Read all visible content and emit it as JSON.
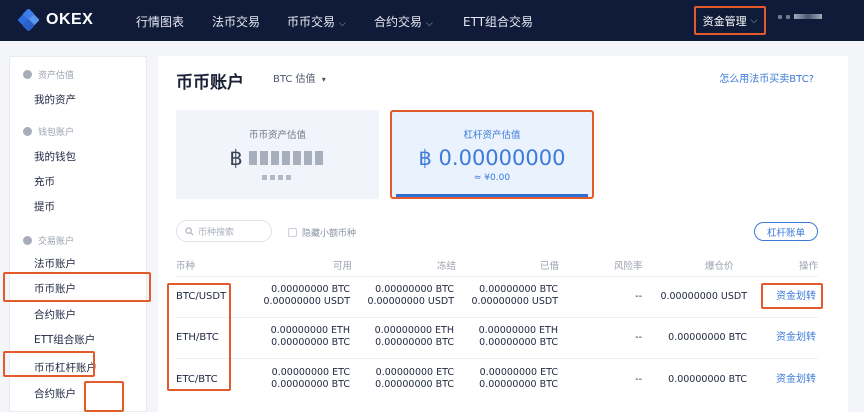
{
  "brand": {
    "name": "OKEX"
  },
  "nav": {
    "items": [
      {
        "label": "行情图表",
        "dropdown": false
      },
      {
        "label": "法币交易",
        "dropdown": false
      },
      {
        "label": "币币交易",
        "dropdown": true
      },
      {
        "label": "合约交易",
        "dropdown": true
      },
      {
        "label": "ETT组合交易",
        "dropdown": false
      }
    ],
    "fund_management": "资金管理"
  },
  "sidebar": {
    "groups": [
      {
        "label": "资产估值",
        "items": [
          "我的资产"
        ]
      },
      {
        "label": "钱包账户",
        "items": [
          "我的钱包",
          "充币",
          "提币"
        ]
      },
      {
        "label": "交易账户",
        "items": [
          "法币账户",
          "币币账户",
          "合约账户",
          "ETT组合账户",
          "币币杠杆账户",
          "合约账户"
        ]
      }
    ]
  },
  "main": {
    "title": "币币账户",
    "valuation_select": "BTC 估值",
    "help_link": "怎么用法币买卖BTC?",
    "spot_card": {
      "label": "币币资产估值",
      "currency_symbol": "฿"
    },
    "margin_card": {
      "label": "杠杆资产估值",
      "value": "฿ 0.00000000",
      "fiat": "≈ ¥0.00"
    },
    "search_placeholder": "币种搜索",
    "hide_small": "隐藏小额币种",
    "margin_bill": "杠杆账单",
    "table": {
      "headers": [
        "币种",
        "可用",
        "冻结",
        "已借",
        "风险率",
        "爆仓价",
        "操作"
      ],
      "rows": [
        {
          "pair": "BTC/USDT",
          "available": [
            "0.00000000 BTC",
            "0.00000000 USDT"
          ],
          "frozen": [
            "0.00000000 BTC",
            "0.00000000 USDT"
          ],
          "borrowed": [
            "0.00000000 BTC",
            "0.00000000 USDT"
          ],
          "risk": "--",
          "liq_price": "0.00000000 USDT",
          "action": "资金划转"
        },
        {
          "pair": "ETH/BTC",
          "available": [
            "0.00000000 ETH",
            "0.00000000 BTC"
          ],
          "frozen": [
            "0.00000000 ETH",
            "0.00000000 BTC"
          ],
          "borrowed": [
            "0.00000000 ETH",
            "0.00000000 BTC"
          ],
          "risk": "--",
          "liq_price": "0.00000000 BTC",
          "action": "资金划转"
        },
        {
          "pair": "ETC/BTC",
          "available": [
            "0.00000000 ETC",
            "0.00000000 BTC"
          ],
          "frozen": [
            "0.00000000 ETC",
            "0.00000000 BTC"
          ],
          "borrowed": [
            "0.00000000 ETC",
            "0.00000000 BTC"
          ],
          "risk": "--",
          "liq_price": "0.00000000 BTC",
          "action": "资金划转"
        }
      ]
    }
  },
  "colors": {
    "nav_bg": "#0f1b38",
    "accent_blue": "#3c7bd9",
    "highlight": "#e35a2b"
  }
}
